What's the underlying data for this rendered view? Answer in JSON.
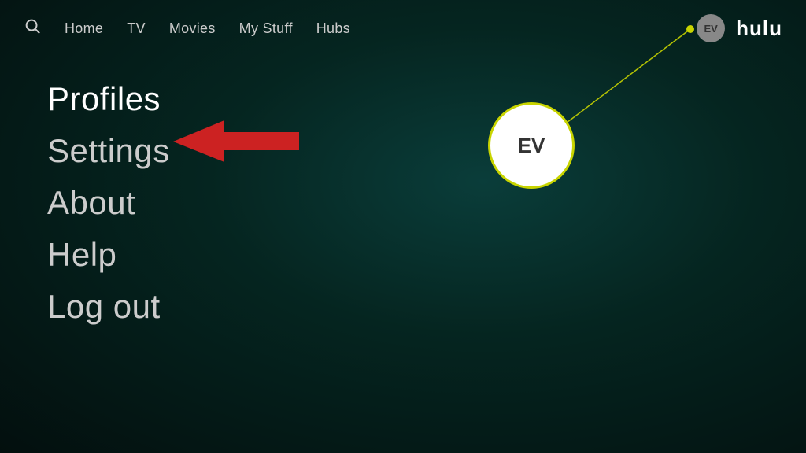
{
  "nav": {
    "search_icon": "🔍",
    "items": [
      {
        "label": "Home"
      },
      {
        "label": "TV"
      },
      {
        "label": "Movies"
      },
      {
        "label": "My Stuff"
      },
      {
        "label": "Hubs"
      }
    ],
    "avatar_initials": "EV",
    "logo": "hulu"
  },
  "menu": {
    "items": [
      {
        "label": "Profiles"
      },
      {
        "label": "Settings"
      },
      {
        "label": "About"
      },
      {
        "label": "Help"
      },
      {
        "label": "Log out"
      }
    ]
  },
  "avatar_large": {
    "initials": "EV"
  },
  "colors": {
    "accent_yellow": "#c8d400",
    "arrow_red": "#cc2222"
  }
}
